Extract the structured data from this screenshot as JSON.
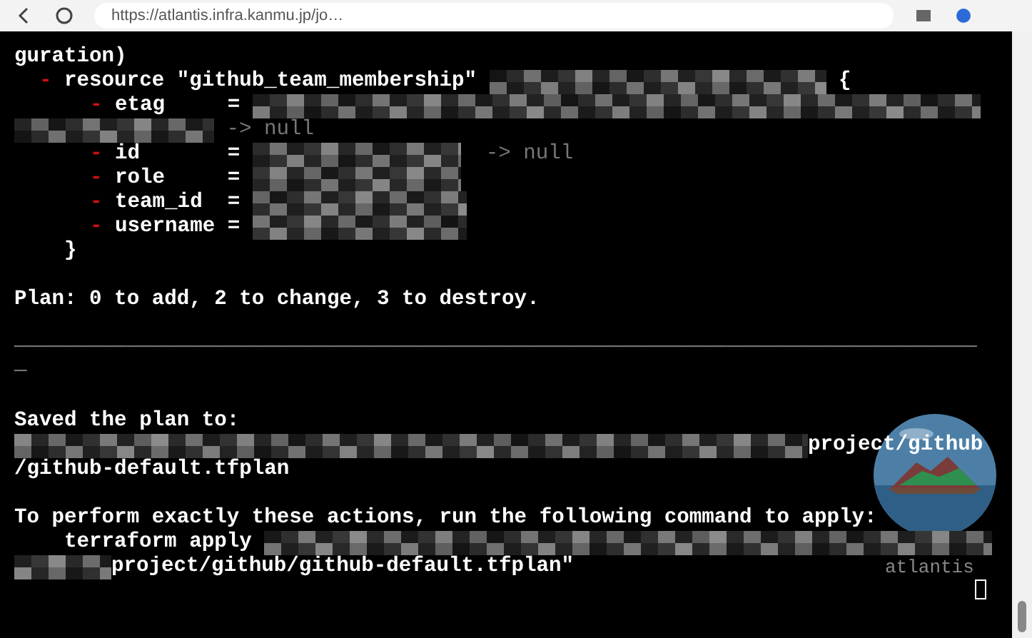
{
  "browser": {
    "url": "https://atlantis.infra.kanmu.jp/jo…"
  },
  "terminal": {
    "lines": [
      {
        "kind": "plain",
        "segments": [
          {
            "kind": "text",
            "text": "guration)"
          }
        ]
      },
      {
        "kind": "resource",
        "segments": [
          {
            "kind": "dash",
            "text": "-"
          },
          {
            "kind": "text",
            "text": " resource \"github_team_membership\" "
          },
          {
            "kind": "redacted"
          },
          {
            "kind": "text",
            "text": " {"
          }
        ]
      },
      {
        "kind": "attribute",
        "segments": [
          {
            "kind": "dash",
            "text": "-"
          },
          {
            "kind": "text",
            "text": " etag     = "
          },
          {
            "kind": "redacted"
          }
        ]
      },
      {
        "kind": "plain",
        "segments": [
          {
            "kind": "redacted"
          },
          {
            "kind": "faint",
            "text": " -> null"
          }
        ]
      },
      {
        "kind": "attribute",
        "segments": [
          {
            "kind": "dash",
            "text": "-"
          },
          {
            "kind": "text",
            "text": " id       = "
          },
          {
            "kind": "redacted"
          },
          {
            "kind": "faint",
            "text": "  -> null"
          }
        ]
      },
      {
        "kind": "attribute",
        "segments": [
          {
            "kind": "dash",
            "text": "-"
          },
          {
            "kind": "text",
            "text": " role     = "
          },
          {
            "kind": "redacted"
          }
        ]
      },
      {
        "kind": "attribute",
        "segments": [
          {
            "kind": "dash",
            "text": "-"
          },
          {
            "kind": "text",
            "text": " team_id  = "
          },
          {
            "kind": "redacted"
          }
        ]
      },
      {
        "kind": "attribute",
        "segments": [
          {
            "kind": "dash",
            "text": "-"
          },
          {
            "kind": "text",
            "text": " username = "
          },
          {
            "kind": "redacted"
          }
        ]
      },
      {
        "kind": "closing",
        "segments": [
          {
            "kind": "text",
            "text": "}"
          }
        ]
      },
      {
        "kind": "blank"
      },
      {
        "kind": "plain",
        "segments": [
          {
            "kind": "text",
            "text": "Plan: 0 to add, 2 to change, 3 to destroy."
          }
        ]
      },
      {
        "kind": "blank"
      },
      {
        "kind": "plain",
        "segments": [
          {
            "kind": "faint",
            "text": "─────────────────────────────────────────────────────────────────────────────"
          }
        ]
      },
      {
        "kind": "plain",
        "segments": [
          {
            "kind": "faint",
            "text": "─"
          }
        ]
      },
      {
        "kind": "blank"
      },
      {
        "kind": "plain",
        "segments": [
          {
            "kind": "text",
            "text": "Saved the plan to:"
          }
        ]
      },
      {
        "kind": "plain",
        "segments": [
          {
            "kind": "redacted"
          },
          {
            "kind": "text",
            "text": "project/github"
          }
        ]
      },
      {
        "kind": "plain",
        "segments": [
          {
            "kind": "text",
            "text": "/github-default.tfplan"
          }
        ]
      },
      {
        "kind": "blank"
      },
      {
        "kind": "plain",
        "segments": [
          {
            "kind": "text",
            "text": "To perform exactly these actions, run the following command to apply:"
          }
        ]
      },
      {
        "kind": "command",
        "segments": [
          {
            "kind": "text",
            "text": "terraform apply "
          },
          {
            "kind": "redacted"
          }
        ]
      },
      {
        "kind": "plain",
        "segments": [
          {
            "kind": "redacted"
          },
          {
            "kind": "text",
            "text": "project/github/github-default.tfplan\""
          }
        ]
      }
    ]
  },
  "logo": {
    "caption": "atlantis"
  }
}
